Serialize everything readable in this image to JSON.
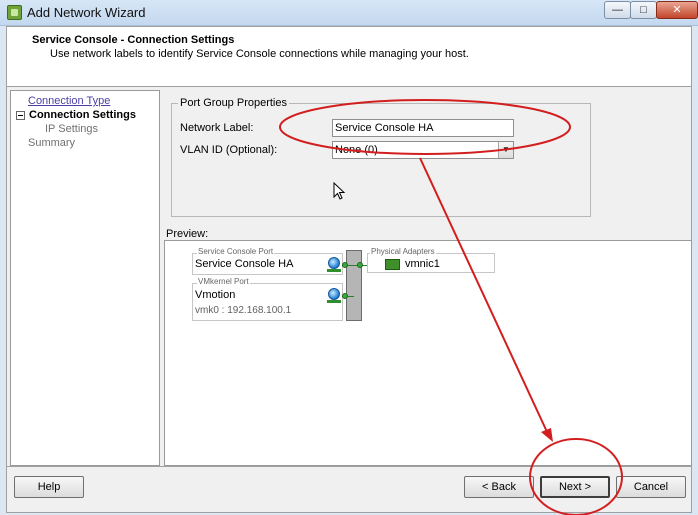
{
  "window": {
    "title": "Add Network Wizard",
    "controls": [
      "—",
      "□",
      "✕"
    ]
  },
  "header": {
    "title": "Service Console - Connection Settings",
    "subtitle": "Use network labels to identify Service Console connections while managing your host."
  },
  "nav": {
    "items": [
      {
        "label": "Connection Type"
      },
      {
        "label": "Connection Settings"
      },
      {
        "label": "IP Settings"
      },
      {
        "label": "Summary"
      }
    ]
  },
  "port_group": {
    "legend": "Port Group Properties",
    "network_label_label": "Network Label:",
    "network_label_value": "Service Console HA",
    "vlan_label": "VLAN ID (Optional):",
    "vlan_value": "None (0)"
  },
  "preview": {
    "label": "Preview:",
    "service_console": {
      "caption": "Service Console Port",
      "name": "Service Console HA"
    },
    "vmkernel": {
      "caption": "VMkernel Port",
      "name": "Vmotion",
      "detail": "vmk0 : 192.168.100.1"
    },
    "physical_adapters": {
      "caption": "Physical Adapters",
      "nic": "vmnic1"
    }
  },
  "buttons": {
    "help": "Help",
    "back": "< Back",
    "next": "Next >",
    "cancel": "Cancel"
  },
  "colors": {
    "annotation": "#d21e1e",
    "link": "#4b3fa6"
  }
}
